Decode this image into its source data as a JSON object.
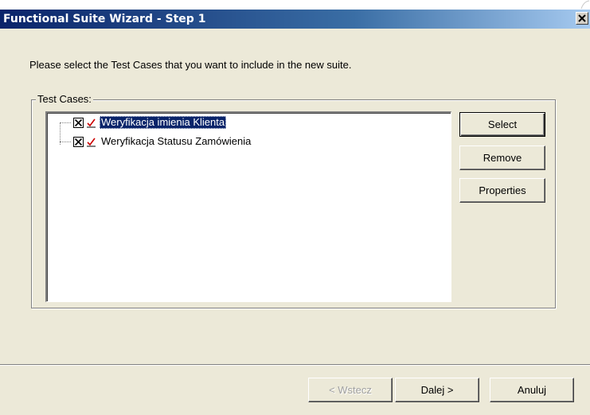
{
  "window": {
    "title": "Functional Suite Wizard - Step 1",
    "close_icon": "close-icon"
  },
  "instruction": "Please select the Test Cases that you want to include in the new suite.",
  "test_cases_group": {
    "label": "Test Cases:",
    "items": [
      {
        "label": "Weryfikacja imienia Klienta",
        "checked": true,
        "selected": true
      },
      {
        "label": "Weryfikacja Statusu Zamówienia",
        "checked": true,
        "selected": false
      }
    ]
  },
  "side_buttons": {
    "select": "Select",
    "remove": "Remove",
    "properties": "Properties"
  },
  "footer_buttons": {
    "back": "< Wstecz",
    "next": "Dalej >",
    "cancel": "Anuluj"
  },
  "colors": {
    "title_bar": "#0a246a",
    "dialog_bg": "#ece9d8",
    "selection": "#0a246a",
    "check_mark": "#cc0000"
  }
}
